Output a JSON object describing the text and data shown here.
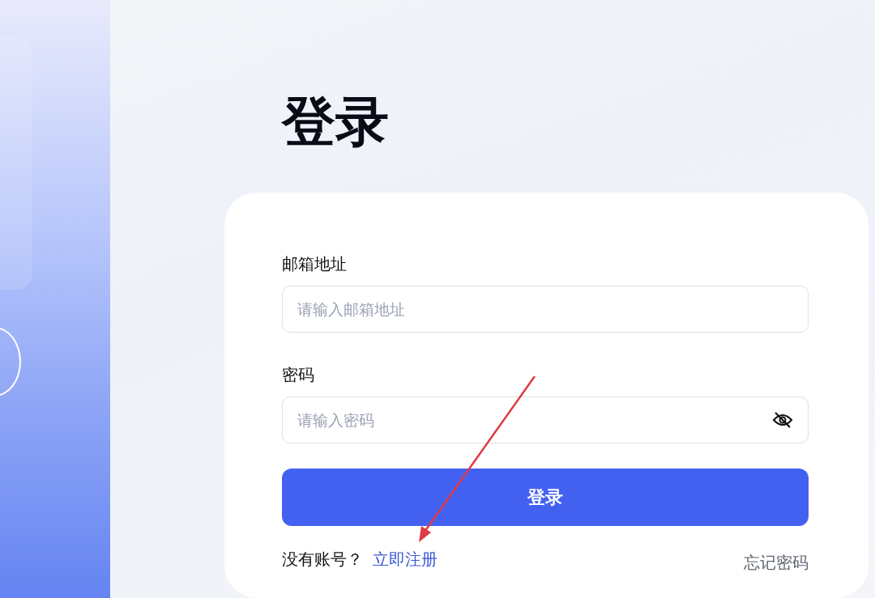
{
  "title": "登录",
  "fields": [
    {
      "label": "邮箱地址",
      "placeholder": "请输入邮箱地址",
      "kind": "text"
    },
    {
      "label": "密码",
      "placeholder": "请输入密码",
      "kind": "password"
    }
  ],
  "submit": "登录",
  "signup_prompt": "没有账号？",
  "signup_link": "立即注册",
  "forgot_link": "忘记密码"
}
